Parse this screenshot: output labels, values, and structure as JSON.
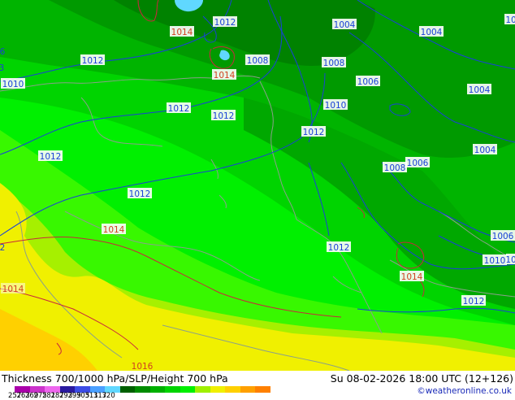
{
  "header": {
    "title_left": "Thickness 700/1000 hPa/SLP/Height 700 hPa",
    "title_right": "Su 08-02-2026 18:00 UTC (12+126)",
    "credit": "©weatheronline.co.uk"
  },
  "colorbar": {
    "colors": [
      "#aa00aa",
      "#cc33cc",
      "#ee66ee",
      "#2a1aa0",
      "#3c4ce6",
      "#4aa0ff",
      "#60d8ff",
      "#006000",
      "#008c00",
      "#00b000",
      "#00d400",
      "#00f000",
      "#a0f000",
      "#f0f000",
      "#ffd000",
      "#ffa000",
      "#ff8000"
    ],
    "tick_labels": [
      "257",
      "263",
      "269",
      "275",
      "281",
      "287",
      "293",
      "299",
      "305",
      "311",
      "317",
      "320"
    ]
  },
  "map": {
    "pressure_labels": [
      {
        "text": "1014",
        "style": "red"
      },
      {
        "text": "1012",
        "style": "blue"
      },
      {
        "text": "1004",
        "style": "blue"
      },
      {
        "text": "1004",
        "style": "blue"
      },
      {
        "text": "10",
        "style": "blue"
      },
      {
        "text": "1012",
        "style": "blue"
      },
      {
        "text": "1008",
        "style": "blue"
      },
      {
        "text": "1008",
        "style": "blue"
      },
      {
        "text": "1014",
        "style": "red"
      },
      {
        "text": "1006",
        "style": "blue"
      },
      {
        "text": "1010",
        "style": "blue"
      },
      {
        "text": "1004",
        "style": "blue"
      },
      {
        "text": "1012",
        "style": "blue"
      },
      {
        "text": "1012",
        "style": "blue"
      },
      {
        "text": "1010",
        "style": "blue"
      },
      {
        "text": "1012",
        "style": "blue"
      },
      {
        "text": "1012",
        "style": "blue"
      },
      {
        "text": "1004",
        "style": "blue"
      },
      {
        "text": "1008",
        "style": "blue"
      },
      {
        "text": "1006",
        "style": "blue"
      },
      {
        "text": "1012",
        "style": "blue"
      },
      {
        "text": "1014",
        "style": "red"
      },
      {
        "text": "1012",
        "style": "blue"
      },
      {
        "text": "1006",
        "style": "blue"
      },
      {
        "text": "1010",
        "style": "blue"
      },
      {
        "text": "10",
        "style": "blue"
      },
      {
        "text": "1014",
        "style": "red"
      },
      {
        "text": "1014",
        "style": "red"
      },
      {
        "text": "1012",
        "style": "blue"
      },
      {
        "text": "1016",
        "style": "red"
      },
      {
        "text": "6",
        "style": "blue"
      },
      {
        "text": "3",
        "style": "blue"
      },
      {
        "text": "2",
        "style": "blue"
      }
    ]
  }
}
